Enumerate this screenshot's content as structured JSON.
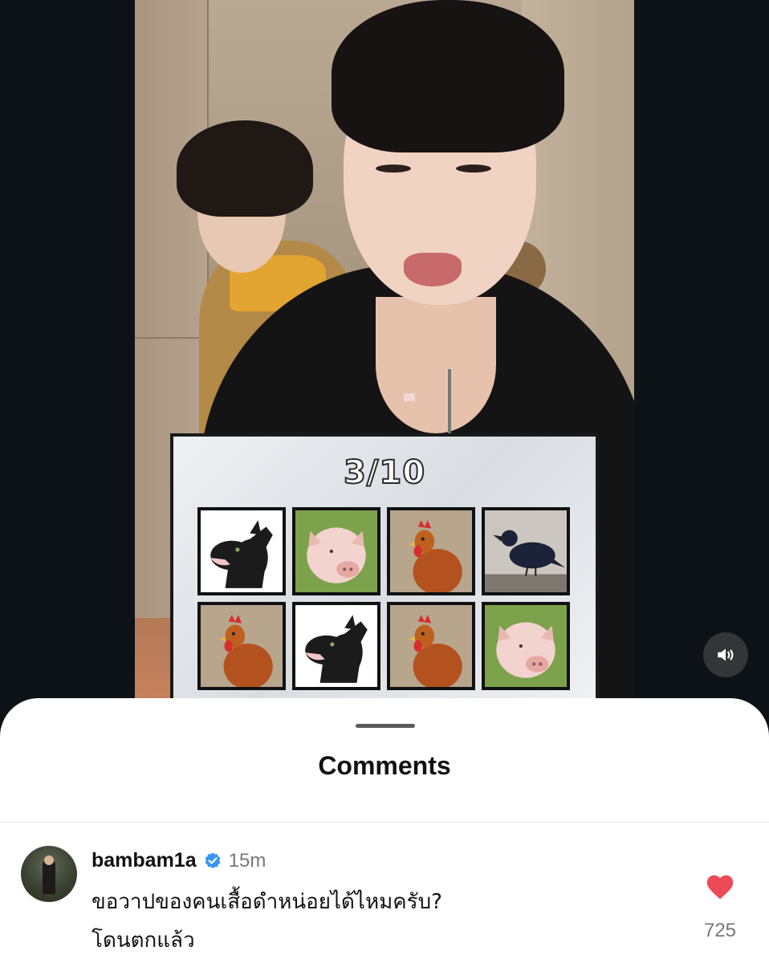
{
  "video": {
    "game_board": {
      "score": "3/10",
      "cards": [
        {
          "animal": "dog",
          "icon": "dog-icon"
        },
        {
          "animal": "pig",
          "icon": "pig-icon"
        },
        {
          "animal": "rooster",
          "icon": "rooster-icon"
        },
        {
          "animal": "crow",
          "icon": "crow-icon"
        },
        {
          "animal": "rooster",
          "icon": "rooster-icon"
        },
        {
          "animal": "dog",
          "icon": "dog-icon"
        },
        {
          "animal": "rooster",
          "icon": "rooster-icon"
        },
        {
          "animal": "pig",
          "icon": "pig-icon"
        }
      ]
    },
    "volume_icon": "speaker-volume-icon"
  },
  "comments_sheet": {
    "title": "Comments",
    "comment": {
      "username": "bambam1a",
      "verified": true,
      "time": "15m",
      "text_line1": "ขอวาปของคนเสื้อดำหน่อยได้ไหมครับ?",
      "text_line2": "โดนตกแล้ว",
      "likes": "725",
      "liked": true
    }
  },
  "colors": {
    "like_red": "#ed4956",
    "verified_blue": "#3897f0",
    "sheet_bg": "#ffffff",
    "page_bg": "#0d1216"
  }
}
